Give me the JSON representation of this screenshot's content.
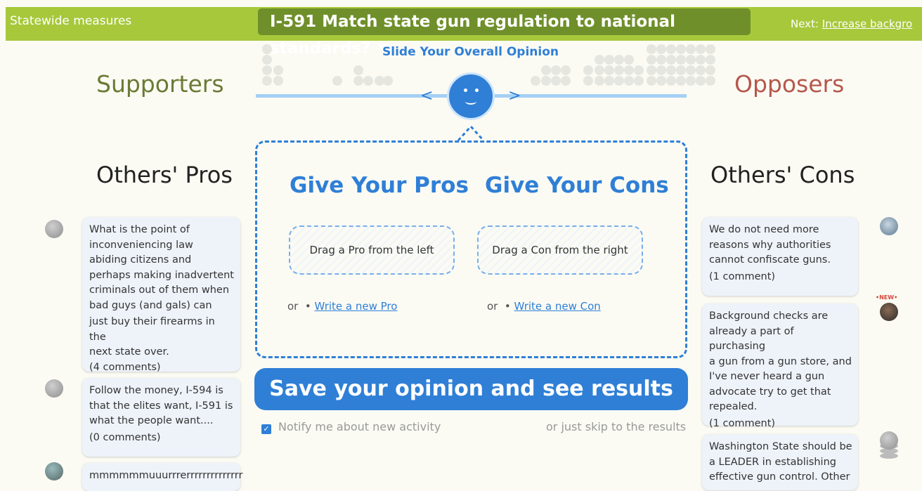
{
  "header": {
    "section": "Statewide measures",
    "measure_title": "I-591 Match state gun regulation to national standards?",
    "next_prefix": "Next:",
    "next_link": "Increase backgro"
  },
  "slider": {
    "label": "Slide Your Overall Opinion",
    "left_arrow": "<",
    "right_arrow": ">",
    "position": 0.5
  },
  "columns": {
    "supporters": "Supporters",
    "opposers": "Opposers",
    "others_pros": "Others' Pros",
    "others_cons": "Others' Cons"
  },
  "center": {
    "give_pros": "Give Your Pros",
    "give_cons": "Give Your Cons",
    "drag_pro": "Drag a Pro from the left",
    "drag_con": "Drag a Con from the right",
    "or": "or",
    "bullet": "•",
    "write_pro": "Write a new Pro",
    "write_con": "Write a new Con",
    "save_button": "Save your opinion and see results",
    "notify": "Notify me about new activity",
    "skip": "or just skip to the results"
  },
  "pros": [
    {
      "lines": [
        "What is the point of",
        "inconveniencing law",
        "abiding citizens and",
        "perhaps making inadvertent",
        "criminals out of them when",
        "bad guys (and gals) can",
        "just buy their firearms in the",
        "next state over."
      ],
      "comments": "(4 comments)"
    },
    {
      "lines": [
        "Follow the money, I-594 is",
        "that the elites want, I-591 is",
        "what the people want...."
      ],
      "comments": "(0 comments)"
    },
    {
      "lines": [
        "mmmmmmuuurrrerrrrrrrrrrrrrr"
      ],
      "comments": ""
    }
  ],
  "cons": [
    {
      "lines": [
        "We do not need more",
        "reasons why authorities",
        "cannot confiscate guns."
      ],
      "comments": "(1 comment)"
    },
    {
      "lines": [
        "Background checks are",
        "already a part of purchasing",
        "a gun from a gun store, and",
        "I've never heard a gun",
        "advocate try to get that",
        "repealed."
      ],
      "comments": "(1 comment)"
    },
    {
      "lines": [
        "Washington State should be",
        "a LEADER in establishing",
        "effective gun control. Other"
      ],
      "comments": ""
    }
  ],
  "badges": {
    "new": "•NEW•"
  },
  "colors": {
    "header_green": "#a7c83b",
    "title_green": "#6f8f2a",
    "accent_blue": "#2f7fd6",
    "supporters": "#6b7a35",
    "opposers": "#b6574c"
  },
  "icons": {
    "checkbox": "check-icon",
    "title_caret": "chevron-down-icon"
  }
}
